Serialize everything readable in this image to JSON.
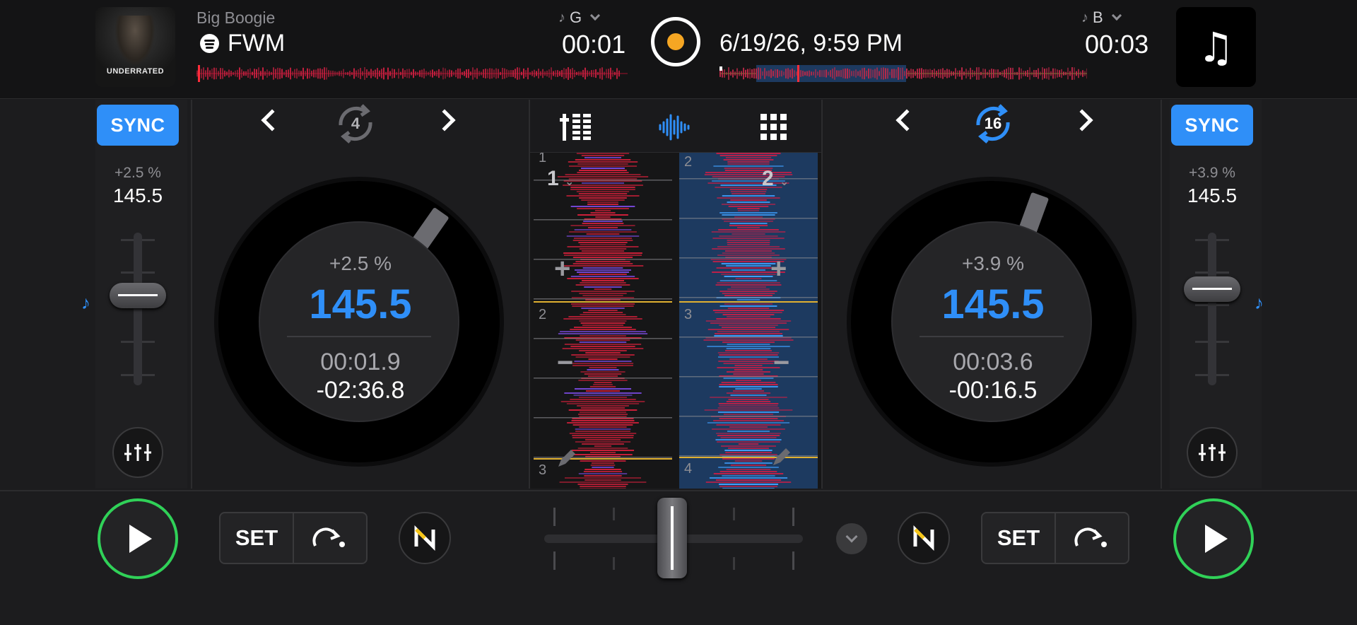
{
  "deck_a": {
    "artist": "Big Boogie",
    "title": "FWM",
    "artwork_text": "UNDERRATED",
    "key": "G",
    "time": "00:01",
    "sync_label": "SYNC",
    "pitch": "+2.5 %",
    "bpm": "145.5",
    "loop_size": "4",
    "platter_pitch": "+2.5 %",
    "platter_bpm": "145.5",
    "elapsed": "00:01.9",
    "remaining": "-02:36.8",
    "set_label": "SET",
    "deck_number": "1",
    "bar_numbers": [
      "1",
      "2",
      "3"
    ]
  },
  "deck_b": {
    "key": "B",
    "time": "00:03",
    "sync_label": "SYNC",
    "pitch": "+3.9 %",
    "bpm": "145.5",
    "loop_size": "16",
    "platter_pitch": "+3.9 %",
    "platter_bpm": "145.5",
    "elapsed": "00:03.6",
    "remaining": "-00:16.5",
    "set_label": "SET",
    "deck_number": "2",
    "bar_numbers": [
      "2",
      "3",
      "4"
    ]
  },
  "recording": {
    "datetime": "6/19/26, 9:59 PM"
  },
  "icons": {
    "note": "music-note-icon",
    "spotify": "spotify-icon",
    "record": "record-icon",
    "loop": "loop-icon",
    "eq": "mixer-sliders-icon",
    "play": "play-icon",
    "jump": "jump-arrow-icon",
    "neural": "neural-mix-icon"
  },
  "colors": {
    "accent_blue": "#2f8ff8",
    "play_green": "#30d158",
    "record_orange": "#f5a623",
    "waveform_red": "#d0203a"
  }
}
